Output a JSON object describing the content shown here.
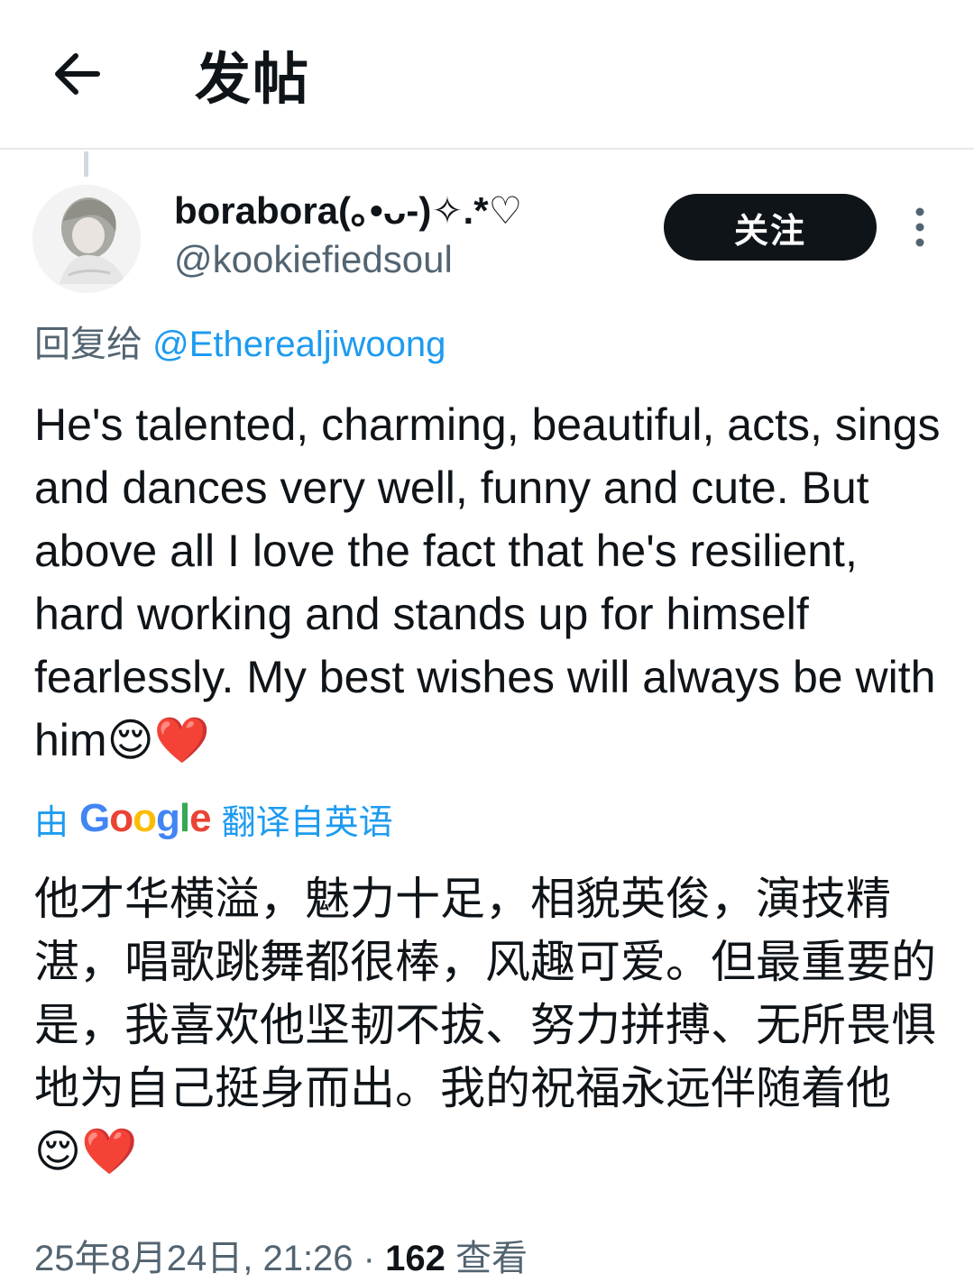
{
  "header": {
    "back_icon": "arrow-left-icon",
    "title": "发帖"
  },
  "post": {
    "author": {
      "display_name": "borabora(｡•ᴗ-)✧.*♡",
      "handle": "@kookiefiedsoul",
      "avatar_icon": "avatar-image"
    },
    "follow_label": "关注",
    "more_icon": "more-vertical-icon",
    "reply_prefix": "回复给 ",
    "reply_to": "@Etherealjiwoong",
    "text": "He's talented, charming, beautiful, acts, sings and dances very well, funny and cute. But above all I love the fact that he's resilient, hard working and stands up for himself fearlessly. My best wishes will always be with him😌❤️",
    "translation": {
      "prefix": "由",
      "provider": "Google",
      "suffix": "翻译自英语",
      "text": "他才华横溢，魅力十足，相貌英俊，演技精湛，唱歌跳舞都很棒，风趣可爱。但最重要的是，我喜欢他坚韧不拔、努力拼搏、无所畏惧地为自己挺身而出。我的祝福永远伴随着他😌❤️"
    },
    "meta": {
      "timestamp": "25年8月24日, 21:26",
      "separator": " · ",
      "view_count": "162",
      "view_label": " 查看"
    }
  },
  "colors": {
    "link": "#1d9bf0",
    "secondary_text": "#536471",
    "primary_text": "#0f1419",
    "follow_bg": "#0f1419"
  }
}
